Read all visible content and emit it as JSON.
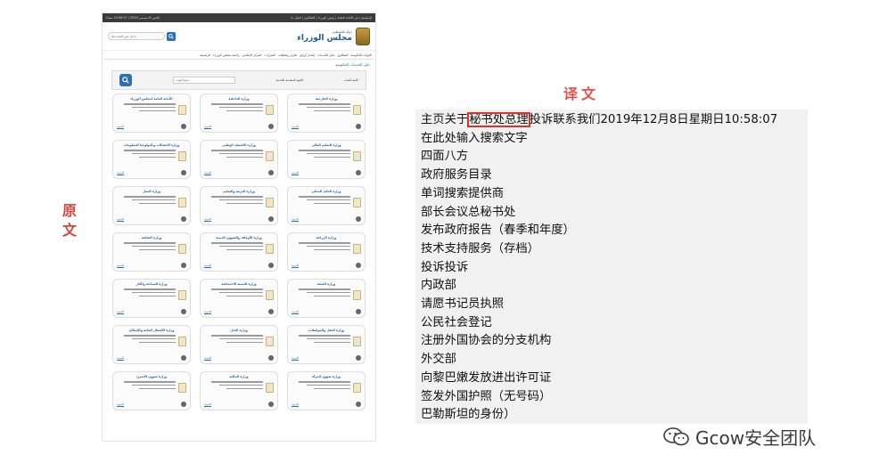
{
  "labels": {
    "original_vertical": [
      "原",
      "文"
    ],
    "translation_title": "译文",
    "watermark": "Gcow安全团队"
  },
  "original": {
    "topbar_left": "الإثنين 8 ديسمبر 2019 | 10:58:07 مساءً",
    "topbar_right": "الرئيسية | عن الأمانة العامة | رئيس الوزراء | الشكاوى | اتصل بنا",
    "search_placeholder": "ادخل نص البحث هنا",
    "logo_small": "دولة فلسطين",
    "logo_big": "مجلس الوزراء",
    "nav": [
      "الرئيسية",
      "رئاسة مجلس الوزراء",
      "المركز الإعلامي",
      "القرارات",
      "تقارير وتحليلات",
      "إصدار أوراق",
      "دليل الخدمات",
      "الشكاوي",
      "الجهات الحكومية"
    ],
    "section_title": "دليل الخدمات الحكومية",
    "filter_label": "كلمة البحث",
    "filter_select": "جميع الجهات",
    "filter_label2": "الجهة المقدمة للخدمة",
    "card_more": "المزيد",
    "cards": [
      {
        "title": "الأمانة العامة لمجلس الوزراء"
      },
      {
        "title": "وزارة الداخلية"
      },
      {
        "title": "وزارة الخارجية"
      },
      {
        "title": "وزارة الاتصالات وتكنولوجيا المعلومات"
      },
      {
        "title": "وزارة الاقتصاد الوطني"
      },
      {
        "title": "وزارة التعليم العالي"
      },
      {
        "title": "وزارة العمل"
      },
      {
        "title": "وزارة التربية والتعليم"
      },
      {
        "title": "وزارة الحكم المحلي"
      },
      {
        "title": "وزارة الثقافة"
      },
      {
        "title": "وزارة الأوقاف والشؤون الدينية"
      },
      {
        "title": "وزارة الزراعة"
      },
      {
        "title": "وزارة السياحة والآثار"
      },
      {
        "title": "وزارة التنمية الاجتماعية"
      },
      {
        "title": "وزارة الصحة"
      },
      {
        "title": "وزارة الأشغال العامة والإسكان"
      },
      {
        "title": "وزارة العدل"
      },
      {
        "title": "وزارة النقل والمواصلات"
      },
      {
        "title": "وزارة شؤون الأسرى"
      },
      {
        "title": "وزارة المالية"
      },
      {
        "title": "وزارة شؤون المرأة"
      }
    ]
  },
  "translation": {
    "first_line_before": "主页关于",
    "first_line_highlight": "秘书处总理",
    "first_line_after": "投诉联系我们2019年12月8日星期日10:58:07",
    "lines": [
      "在此处输入搜索文字",
      "四面八方",
      "政府服务目录",
      "单词搜索提供商",
      "部长会议总秘书处",
      "发布政府报告（春季和年度）",
      "技术支持服务（存档）",
      "投诉投诉",
      "内政部",
      "请愿书记员执照",
      "公民社会登记",
      "注册外国协会的分支机构",
      "外交部",
      "向黎巴嫩发放进出许可证",
      "签发外国护照（无号码）",
      "巴勒斯坦的身份）"
    ]
  },
  "colors": {
    "label_red": "#d4453f",
    "highlight_box": "#e0302a",
    "panel_bg": "#f1f1f1",
    "site_blue": "#1c5b94"
  }
}
